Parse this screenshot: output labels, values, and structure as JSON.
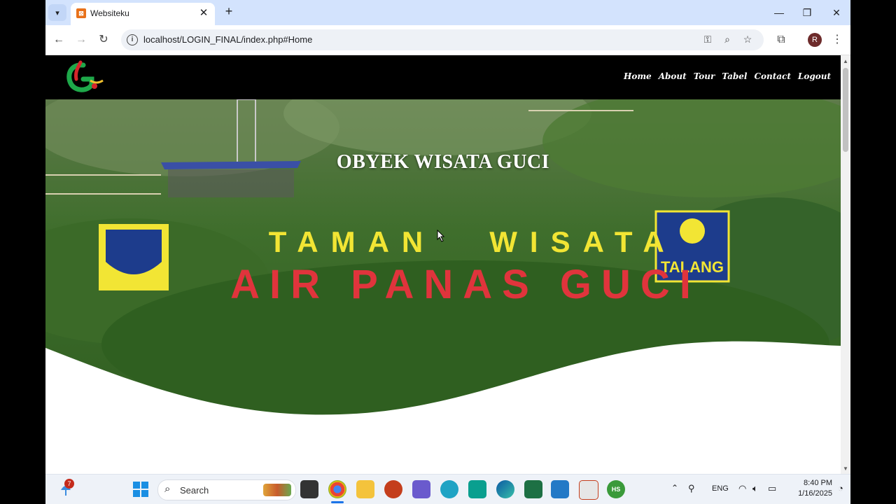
{
  "browser": {
    "tab_title": "Websiteku",
    "url": "localhost/LOGIN_FINAL/index.php#Home",
    "profile_initial": "R"
  },
  "site": {
    "menu": [
      "Home",
      "About",
      "Tour",
      "Tabel",
      "Contact",
      "Logout"
    ],
    "hero_title": "OBYEK WISATA GUCI"
  },
  "taskbar": {
    "search_placeholder": "Search",
    "notification_count": "7",
    "language": "ENG",
    "time": "8:40 PM",
    "date": "1/16/2025",
    "pinned_apps": [
      "file-explorer-icon",
      "chrome-icon",
      "folder-icon",
      "powerpoint-icon",
      "app-cube-icon",
      "app-drop-icon",
      "arduino-icon",
      "edge-icon",
      "excel-icon",
      "vscode-icon",
      "snipping-tool-icon",
      "hs-app-icon"
    ]
  },
  "colors": {
    "tabstrip": "#d3e3fd",
    "nav_bg": "#000000",
    "hero_text": "#ffffff"
  }
}
